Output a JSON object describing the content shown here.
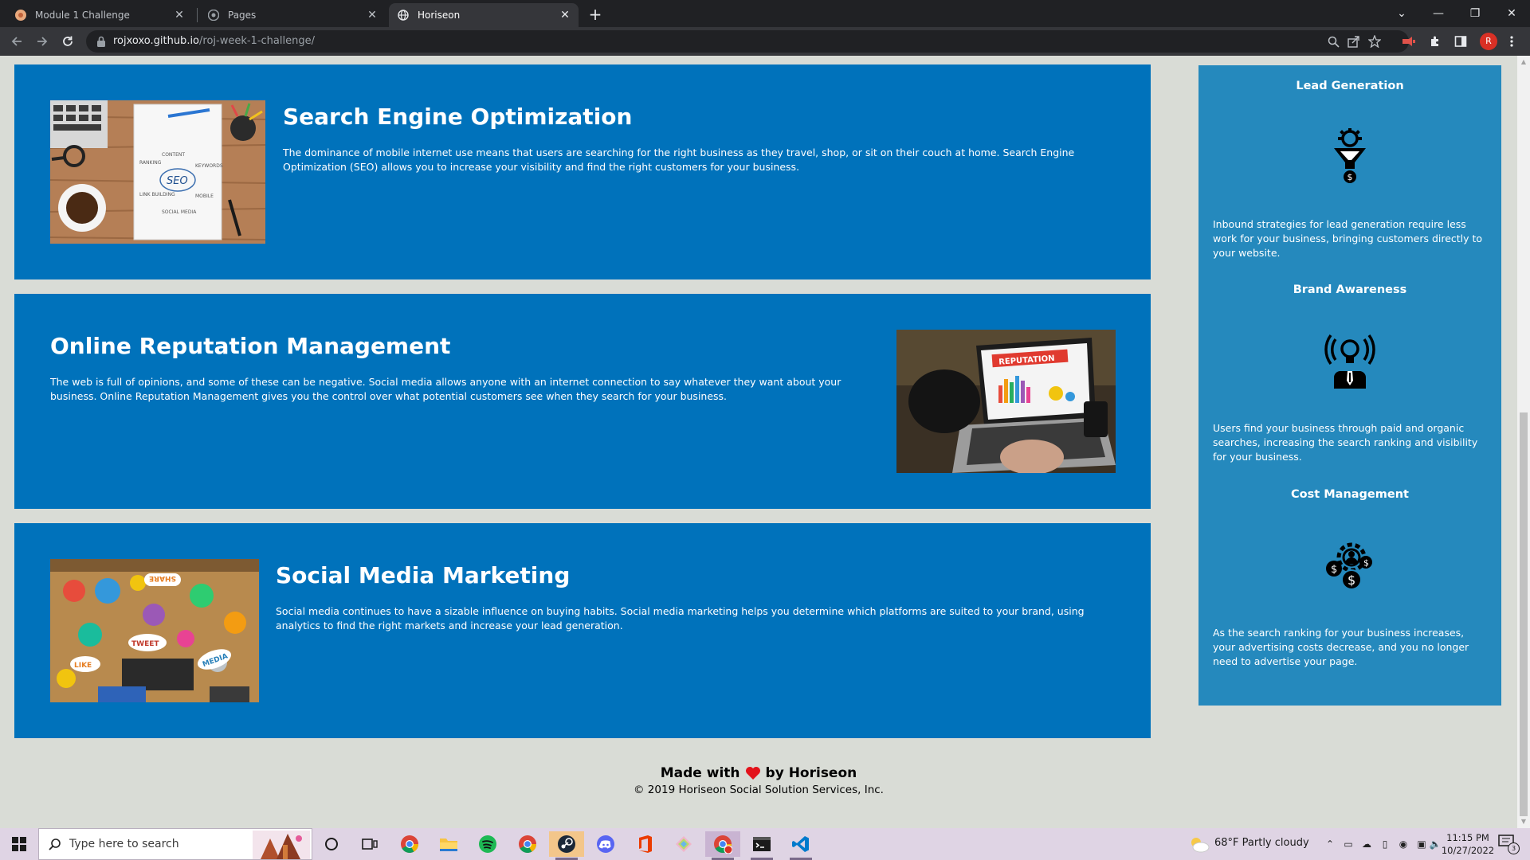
{
  "browser": {
    "tabs": [
      {
        "title": "Module 1 Challenge",
        "active": false,
        "favicon": "orange-circle-icon"
      },
      {
        "title": "Pages",
        "active": false,
        "favicon": "github-icon"
      },
      {
        "title": "Horiseon",
        "active": true,
        "favicon": "globe-icon"
      }
    ],
    "url_host": "rojxoxo.github.io",
    "url_path": "/roj-week-1-challenge/",
    "profile_initial": "R"
  },
  "content": [
    {
      "id": "seo",
      "title": "Search Engine Optimization",
      "text": "The dominance of mobile internet use means that users are searching for the right business as they travel, shop, or sit on their couch at home. Search Engine Optimization (SEO) allows you to increase your visibility and find the right customers for your business.",
      "image_words": [
        "CONTENT",
        "RANKING",
        "SEO",
        "KEYWORDS",
        "LINK BUILDING",
        "MOBILE",
        "SOCIAL MEDIA"
      ]
    },
    {
      "id": "orm",
      "title": "Online Reputation Management",
      "text": "The web is full of opinions, and some of these can be negative. Social media allows anyone with an internet connection to say whatever they want about your business. Online Reputation Management gives you the control over what potential customers see when they search for your business.",
      "image_words": [
        "REPUTATION"
      ]
    },
    {
      "id": "smm",
      "title": "Social Media Marketing",
      "text": "Social media continues to have a sizable influence on buying habits. Social media marketing helps you determine which platforms are suited to your brand, using analytics to find the right markets and increase your lead generation.",
      "image_words": [
        "SHARE",
        "TWEET",
        "LIKE",
        "MEDIA"
      ]
    }
  ],
  "benefits": [
    {
      "title": "Lead Generation",
      "icon": "funnel-dollar-icon",
      "text": "Inbound strategies for lead generation require less work for your business, bringing customers directly to your website."
    },
    {
      "title": "Brand Awareness",
      "icon": "lightbulb-broadcast-icon",
      "text": "Users find your business through paid and organic searches, increasing the search ranking and visibility for your business."
    },
    {
      "title": "Cost Management",
      "icon": "gear-dollar-icon",
      "text": "As the search ranking for your business increases, your advertising costs decrease, and you no longer need to advertise your page."
    }
  ],
  "footer": {
    "made_prefix": "Made with",
    "made_suffix": "by Horiseon",
    "copyright": "© 2019 Horiseon Social Solution Services, Inc."
  },
  "taskbar": {
    "search_placeholder": "Type here to search",
    "weather": "68°F  Partly cloudy",
    "time": "11:15 PM",
    "date": "10/27/2022",
    "notification_count": "3"
  },
  "colors": {
    "card_bg": "#0072bb",
    "benefit_bg": "#2589bd",
    "page_bg": "#d9dcd6"
  }
}
